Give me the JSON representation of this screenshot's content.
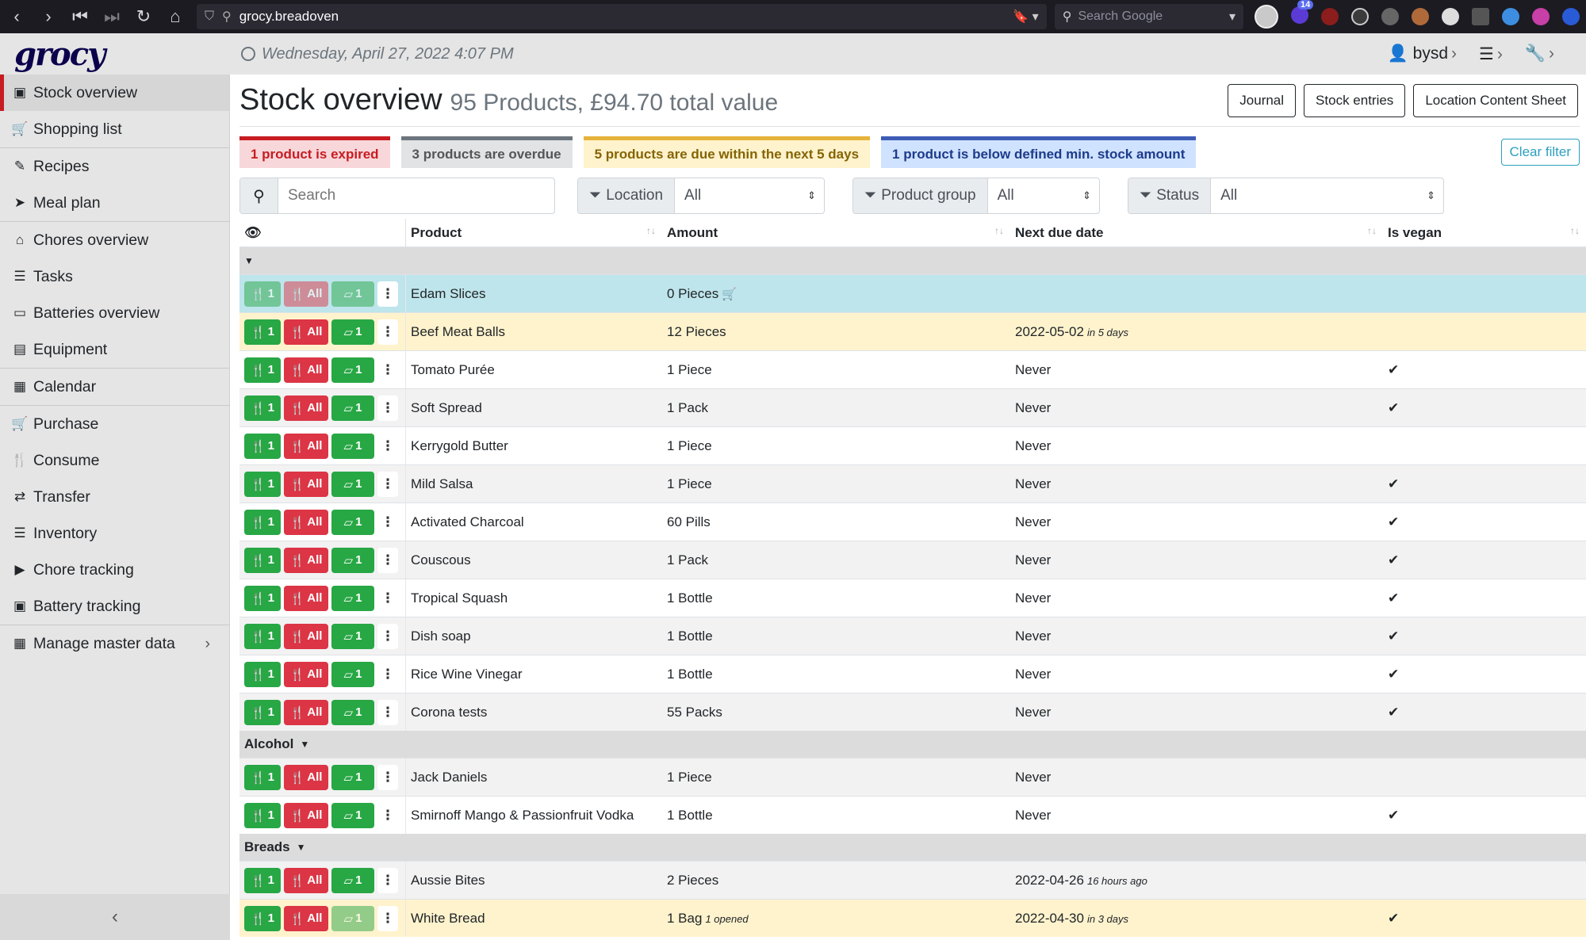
{
  "browser": {
    "url": "grocy.breadoven",
    "search_placeholder": "Search Google",
    "notif_count": "14"
  },
  "app": {
    "logo": "grocy",
    "datetime": "Wednesday, April 27, 2022 4:07 PM",
    "user": "bysd"
  },
  "sidebar": {
    "items": [
      {
        "label": "Stock overview",
        "icon": "box-icon"
      },
      {
        "label": "Shopping list",
        "icon": "cart-icon"
      },
      {
        "label": "Recipes",
        "icon": "recipe-icon"
      },
      {
        "label": "Meal plan",
        "icon": "paper-plane-icon"
      },
      {
        "label": "Chores overview",
        "icon": "home-icon"
      },
      {
        "label": "Tasks",
        "icon": "list-icon"
      },
      {
        "label": "Batteries overview",
        "icon": "battery-icon"
      },
      {
        "label": "Equipment",
        "icon": "toolbox-icon"
      },
      {
        "label": "Calendar",
        "icon": "calendar-icon"
      },
      {
        "label": "Purchase",
        "icon": "cart-plus-icon"
      },
      {
        "label": "Consume",
        "icon": "utensils-icon"
      },
      {
        "label": "Transfer",
        "icon": "exchange-icon"
      },
      {
        "label": "Inventory",
        "icon": "list-icon"
      },
      {
        "label": "Chore tracking",
        "icon": "play-icon"
      },
      {
        "label": "Battery tracking",
        "icon": "car-battery-icon"
      },
      {
        "label": "Manage master data",
        "icon": "table-icon"
      }
    ]
  },
  "page": {
    "title": "Stock overview",
    "subtitle": "95 Products, £94.70 total value",
    "buttons": {
      "journal": "Journal",
      "entries": "Stock entries",
      "location_sheet": "Location Content Sheet"
    },
    "alerts": {
      "expired": "1 product is expired",
      "overdue": "3 products are overdue",
      "due": "5 products are due within the next 5 days",
      "below_min": "1 product is below defined min. stock amount"
    },
    "clear_filter": "Clear filter",
    "search_placeholder": "Search",
    "filters": {
      "location_label": "Location",
      "location_value": "All",
      "group_label": "Product group",
      "group_value": "All",
      "status_label": "Status",
      "status_value": "All"
    }
  },
  "table": {
    "headers": {
      "product": "Product",
      "amount": "Amount",
      "next_due": "Next due date",
      "vegan": "Is vegan"
    },
    "button_labels": {
      "consume_one": "1",
      "consume_all": "All",
      "open_one": "1"
    },
    "groups": [
      {
        "name": "",
        "rows": [
          {
            "product": "Edam Slices",
            "amount": "0 Pieces",
            "extra": "",
            "due": "",
            "due_rel": "",
            "vegan": "",
            "cart": true,
            "style": "info"
          },
          {
            "product": "Beef Meat Balls",
            "amount": "12 Pieces",
            "extra": "",
            "due": "2022-05-02",
            "due_rel": "in 5 days",
            "vegan": "",
            "style": "warn"
          },
          {
            "product": "Tomato Purée",
            "amount": "1 Piece",
            "extra": "",
            "due": "Never",
            "due_rel": "",
            "vegan": "✔",
            "style": ""
          },
          {
            "product": "Soft Spread",
            "amount": "1 Pack",
            "extra": "",
            "due": "Never",
            "due_rel": "",
            "vegan": "✔",
            "style": "striped"
          },
          {
            "product": "Kerrygold Butter",
            "amount": "1 Piece",
            "extra": "",
            "due": "Never",
            "due_rel": "",
            "vegan": "",
            "style": ""
          },
          {
            "product": "Mild Salsa",
            "amount": "1 Piece",
            "extra": "",
            "due": "Never",
            "due_rel": "",
            "vegan": "✔",
            "style": "striped"
          },
          {
            "product": "Activated Charcoal",
            "amount": "60 Pills",
            "extra": "",
            "due": "Never",
            "due_rel": "",
            "vegan": "✔",
            "style": ""
          },
          {
            "product": "Couscous",
            "amount": "1 Pack",
            "extra": "",
            "due": "Never",
            "due_rel": "",
            "vegan": "✔",
            "style": "striped"
          },
          {
            "product": "Tropical Squash",
            "amount": "1 Bottle",
            "extra": "",
            "due": "Never",
            "due_rel": "",
            "vegan": "✔",
            "style": ""
          },
          {
            "product": "Dish soap",
            "amount": "1 Bottle",
            "extra": "",
            "due": "Never",
            "due_rel": "",
            "vegan": "✔",
            "style": "striped"
          },
          {
            "product": "Rice Wine Vinegar",
            "amount": "1 Bottle",
            "extra": "",
            "due": "Never",
            "due_rel": "",
            "vegan": "✔",
            "style": ""
          },
          {
            "product": "Corona tests",
            "amount": "55 Packs",
            "extra": "",
            "due": "Never",
            "due_rel": "",
            "vegan": "✔",
            "style": "striped"
          }
        ]
      },
      {
        "name": "Alcohol",
        "rows": [
          {
            "product": "Jack Daniels",
            "amount": "1 Piece",
            "extra": "",
            "due": "Never",
            "due_rel": "",
            "vegan": "",
            "style": "striped"
          },
          {
            "product": "Smirnoff Mango & Passionfruit Vodka",
            "amount": "1 Bottle",
            "extra": "",
            "due": "Never",
            "due_rel": "",
            "vegan": "✔",
            "style": ""
          }
        ]
      },
      {
        "name": "Breads",
        "rows": [
          {
            "product": "Aussie Bites",
            "amount": "2 Pieces",
            "extra": "",
            "due": "2022-04-26",
            "due_rel": "16 hours ago",
            "vegan": "",
            "style": "striped"
          },
          {
            "product": "White Bread",
            "amount": "1 Bag",
            "extra": "1 opened",
            "due": "2022-04-30",
            "due_rel": "in 3 days",
            "vegan": "✔",
            "style": "warn"
          }
        ]
      }
    ]
  }
}
